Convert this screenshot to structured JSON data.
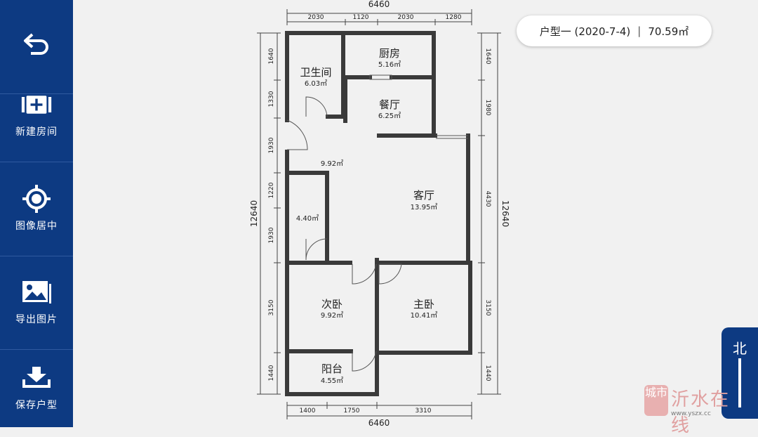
{
  "sidebar": {
    "items": [
      {
        "label": "",
        "icon": "back-arrow-icon"
      },
      {
        "label": "新建房间",
        "icon": "add-room-icon"
      },
      {
        "label": "图像居中",
        "icon": "crosshair-icon"
      },
      {
        "label": "导出图片",
        "icon": "image-icon"
      },
      {
        "label": "保存户型",
        "icon": "download-icon"
      }
    ]
  },
  "header": {
    "plan_name": "户型一 (2020-7-4)",
    "separator": "|",
    "total_area": "70.59㎡"
  },
  "north_button": {
    "label": "北"
  },
  "watermark": {
    "text": "沂水在线",
    "url": "www.yszx.cc",
    "logo_text": "城市"
  },
  "floorplan": {
    "width_label_top": "6460",
    "width_label_bottom": "6460",
    "height_label_left": "12640",
    "height_label_right": "12640",
    "top_dims": [
      "2030",
      "1120",
      "2030",
      "1280"
    ],
    "bottom_dims": [
      "1400",
      "1750",
      "3310"
    ],
    "left_dims": [
      "1640",
      "1330",
      "1930",
      "1220",
      "1930",
      "3150",
      "1440"
    ],
    "right_dims": [
      "1640",
      "1980",
      "4430",
      "3150",
      "1440"
    ],
    "rooms": [
      {
        "name": "卫生间",
        "area": "6.03㎡"
      },
      {
        "name": "厨房",
        "area": "5.16㎡"
      },
      {
        "name": "餐厅",
        "area": "6.25㎡"
      },
      {
        "name": "",
        "area": "9.92㎡"
      },
      {
        "name": "",
        "area": "4.40㎡"
      },
      {
        "name": "客厅",
        "area": "13.95㎡"
      },
      {
        "name": "次卧",
        "area": "9.92㎡"
      },
      {
        "name": "主卧",
        "area": "10.41㎡"
      },
      {
        "name": "阳台",
        "area": "4.55㎡"
      }
    ],
    "colors": {
      "wall": "#3a3a3a",
      "dim_line": "#444444",
      "accent": "#0d3a82"
    }
  }
}
